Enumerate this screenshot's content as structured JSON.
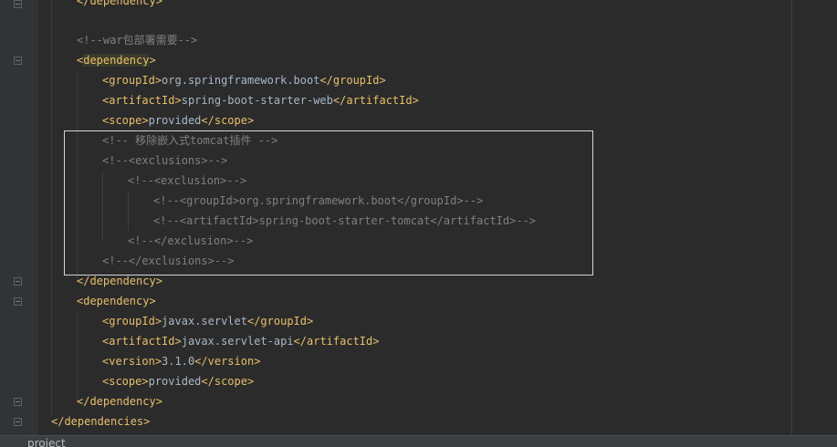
{
  "lines": {
    "l0": {
      "close": "</",
      "name": "dependency",
      "end": ">"
    },
    "l1": {
      "text": "<!--war包部署需要-->"
    },
    "l2": {
      "open": "<",
      "name": "dependency",
      "end": ">"
    },
    "l3": {
      "o": "<",
      "tag": "groupId",
      "c": ">",
      "value": "org.springframework.boot",
      "co": "</",
      "ctag": "groupId",
      "cc": ">"
    },
    "l4": {
      "o": "<",
      "tag": "artifactId",
      "c": ">",
      "value": "spring-boot-starter-web",
      "co": "</",
      "ctag": "artifactId",
      "cc": ">"
    },
    "l5": {
      "o": "<",
      "tag": "scope",
      "c": ">",
      "value": "provided",
      "co": "</",
      "ctag": "scope",
      "cc": ">"
    },
    "l6": {
      "text": "<!-- 移除嵌入式tomcat插件 -->"
    },
    "l7": {
      "text": "<!--<exclusions>-->"
    },
    "l8": {
      "text": "<!--<exclusion>-->"
    },
    "l9": {
      "text": "<!--<groupId>org.springframework.boot</groupId>-->"
    },
    "l10": {
      "text": "<!--<artifactId>spring-boot-starter-tomcat</artifactId>-->"
    },
    "l11": {
      "text": "<!--</exclusion>-->"
    },
    "l12": {
      "text": "<!--</exclusions>-->"
    },
    "l13": {
      "close": "</",
      "name": "dependency",
      "end": ">"
    },
    "l14": {
      "open": "<",
      "name": "dependency",
      "end": ">"
    },
    "l15": {
      "o": "<",
      "tag": "groupId",
      "c": ">",
      "value": "javax.servlet",
      "co": "</",
      "ctag": "groupId",
      "cc": ">"
    },
    "l16": {
      "o": "<",
      "tag": "artifactId",
      "c": ">",
      "value": "javax.servlet-api",
      "co": "</",
      "ctag": "artifactId",
      "cc": ">"
    },
    "l17": {
      "o": "<",
      "tag": "version",
      "c": ">",
      "value": "3.1.0",
      "co": "</",
      "ctag": "version",
      "cc": ">"
    },
    "l18": {
      "o": "<",
      "tag": "scope",
      "c": ">",
      "value": "provided",
      "co": "</",
      "ctag": "scope",
      "cc": ">"
    },
    "l19": {
      "close": "</",
      "name": "dependency",
      "end": ">"
    },
    "l20": {
      "close": "</",
      "name": "dependencies",
      "end": ">"
    }
  },
  "breadcrumb": "project",
  "colors": {
    "background": "#2b2b2b",
    "tag": "#e8bf6a",
    "text": "#a9b7c6",
    "comment": "#808080",
    "selection_border": "#d4d4d4"
  }
}
